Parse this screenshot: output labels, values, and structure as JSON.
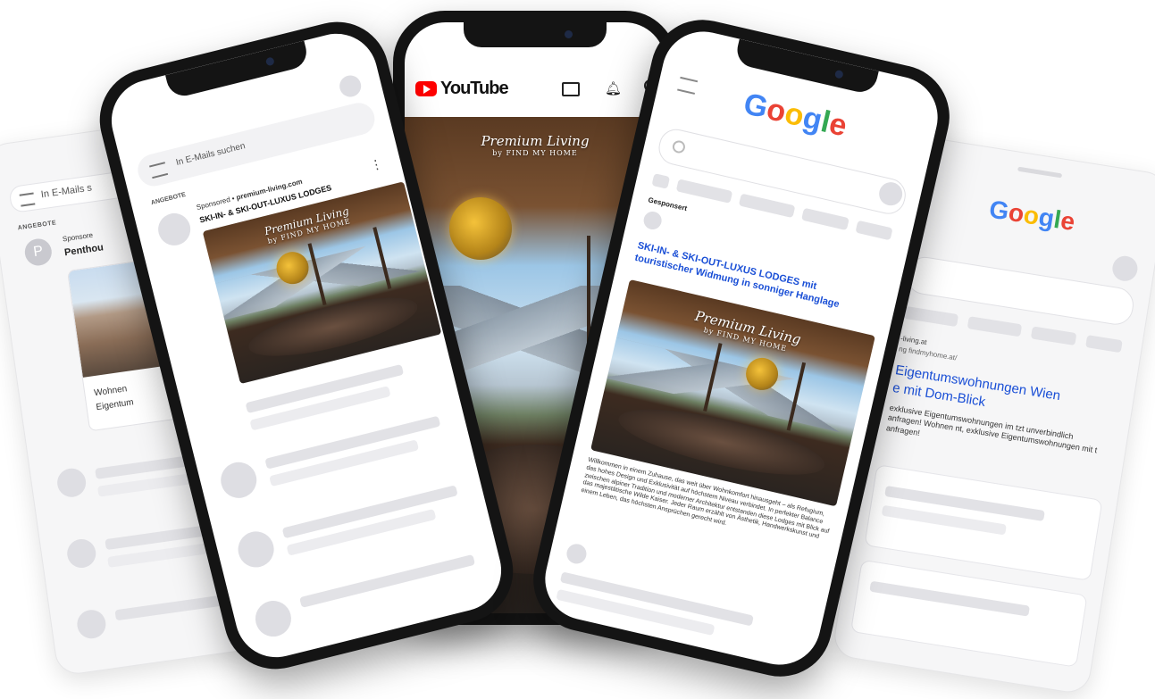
{
  "gmail_left": {
    "search_placeholder": "In E-Mails s",
    "section_label": "ANGEBOTE",
    "avatar_letter": "P",
    "sponsored_line": "Sponsore",
    "subject": "Penthou",
    "snippet_1": "Wohnen",
    "snippet_2": "Eigentum"
  },
  "gmail_phone": {
    "search_placeholder": "In E-Mails suchen",
    "section_label": "ANGEBOTE",
    "sponsored_prefix": "Sponsored • ",
    "sponsor_domain": "premium-living.com",
    "subject": "SKI-IN- & SKI-OUT-LUXUS LODGES",
    "brand_script": "Premium Living",
    "brand_sub": "by FIND MY HOME"
  },
  "youtube_phone": {
    "app_name": "YouTube",
    "brand_script": "Premium Living",
    "brand_sub": "by FIND MY HOME"
  },
  "google_phone": {
    "logo_letters": [
      "G",
      "o",
      "o",
      "g",
      "l",
      "e"
    ],
    "sponsored_label": "Gesponsert",
    "ad_title": "SKI-IN- & SKI-OUT-LUXUS LODGES mit touristischer Widmung in sonniger Hanglage",
    "brand_script": "Premium Living",
    "brand_sub": "by FIND MY HOME",
    "ad_body": "Willkommen in einem Zuhause, das weit über Wohnkomfort hinausgeht – als Refugium, das hohes Design und Exklusivität auf höchstem Niveau verbindet. In perfekter Balance zwischen alpiner Tradition und moderner Architektur entstanden diese Lodges mit Blick auf das majestätische Wilde Kaiser. Jeder Raum erzählt von Ästhetik, Handwerkskunst und einem Leben, das höchsten Ansprüchen gerecht wird."
  },
  "google_right": {
    "logo_letters": [
      "G",
      "o",
      "o",
      "g",
      "l",
      "e"
    ],
    "domain_1": "-living.at",
    "domain_2": "ng findmyhome.at/",
    "ad_title_1": "Eigentumswohnungen Wien",
    "ad_title_2": "e mit Dom-Blick",
    "ad_body": "exklusive Eigentumswohnungen im tzt unverbindlich anfragen! Wohnen nt, exklusive Eigentumswohnungen mit t anfragen!"
  },
  "colors": {
    "youtube_red": "#ff0000",
    "link_blue": "#1a4fd6",
    "phone_frame": "#141414"
  }
}
